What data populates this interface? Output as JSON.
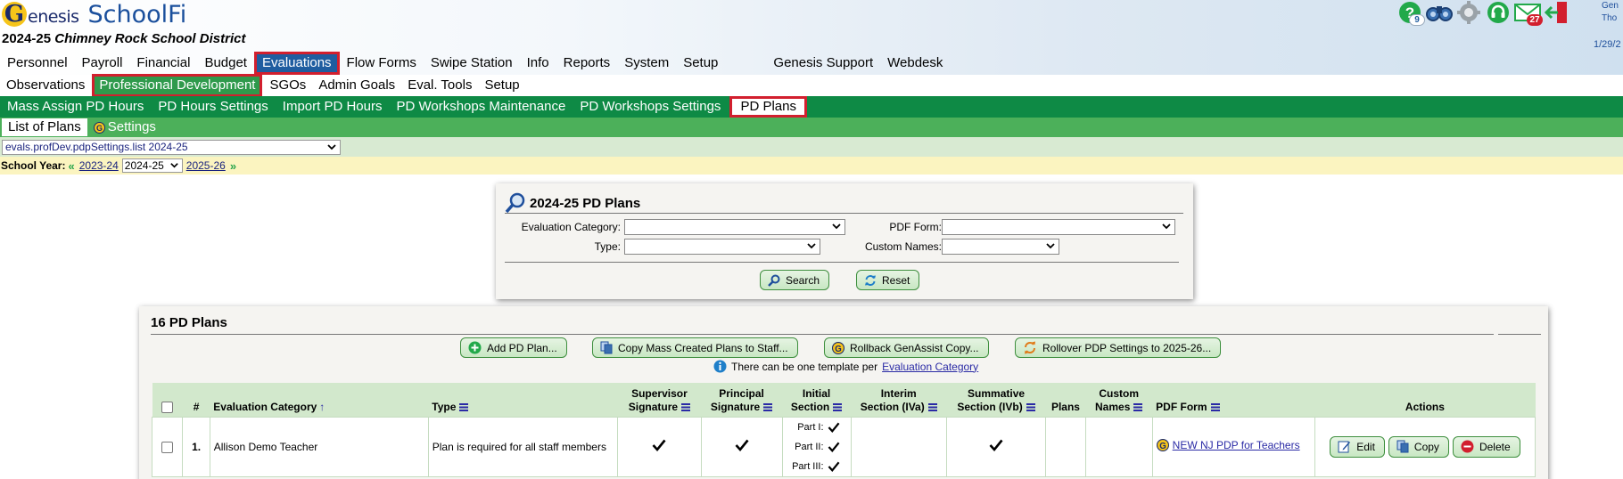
{
  "header": {
    "logo_text": "enesis",
    "logo_letter": "G",
    "app_name": "SchoolFi",
    "year_prefix": "2024-25",
    "district": "Chimney Rock School District",
    "user_line1": "Gen",
    "user_line2": "Tho",
    "date": "1/29/2",
    "help_badge": "9",
    "mail_badge": "27"
  },
  "topnav": [
    "Personnel",
    "Payroll",
    "Financial",
    "Budget",
    "Evaluations",
    "Flow Forms",
    "Swipe Station",
    "Info",
    "Reports",
    "System",
    "Setup",
    "Genesis Support",
    "Webdesk"
  ],
  "topnav_active": "Evaluations",
  "subnav": [
    "Observations",
    "Professional Development",
    "SGOs",
    "Admin Goals",
    "Eval. Tools",
    "Setup"
  ],
  "subnav_active": "Professional Development",
  "thirdnav": [
    "Mass Assign PD Hours",
    "PD Hours Settings",
    "Import PD Hours",
    "PD Workshops Maintenance",
    "PD Workshops Settings",
    "PD Plans"
  ],
  "thirdnav_active": "PD Plans",
  "fourthnav": {
    "list": "List of Plans",
    "settings": "Settings"
  },
  "page_select": "evals.profDev.pdpSettings.list 2024-25",
  "school_year": {
    "label": "School Year:",
    "prev": "2023-24",
    "current": "2024-25",
    "next": "2025-26"
  },
  "search": {
    "title": "2024-25 PD Plans",
    "eval_category_label": "Evaluation Category:",
    "pdf_form_label": "PDF Form:",
    "type_label": "Type:",
    "custom_names_label": "Custom Names:",
    "search_btn": "Search",
    "reset_btn": "Reset"
  },
  "results": {
    "title": "16 PD Plans",
    "add_btn": "Add PD Plan...",
    "copy_btn": "Copy Mass Created Plans to Staff...",
    "rollback_btn": "Rollback GenAssist Copy...",
    "rollover_btn": "Rollover PDP Settings to 2025-26...",
    "note_text": "There can be one template per",
    "note_link": "Evaluation Category",
    "columns": {
      "num": "#",
      "eval_category": "Evaluation Category",
      "type": "Type",
      "supervisor_sig_1": "Supervisor",
      "supervisor_sig_2": "Signature",
      "principal_sig_1": "Principal",
      "principal_sig_2": "Signature",
      "initial_1": "Initial",
      "initial_2": "Section",
      "interim_1": "Interim",
      "interim_2": "Section (IVa)",
      "summative_1": "Summative",
      "summative_2": "Section (IVb)",
      "plans": "Plans",
      "custom_1": "Custom",
      "custom_2": "Names",
      "pdf_form": "PDF Form",
      "actions": "Actions"
    },
    "rows": [
      {
        "num": "1.",
        "eval_category": "Allison Demo Teacher",
        "type": "Plan is required for all staff members",
        "part1": "Part I:",
        "part2": "Part II:",
        "part3": "Part III:",
        "pdf_form": "NEW NJ PDP for Teachers",
        "edit": "Edit",
        "copy": "Copy",
        "delete": "Delete"
      }
    ]
  },
  "colors": {
    "nav_blue": "#1f5da0",
    "nav_green_dark": "#0e8a45",
    "nav_green_light": "#4cb05a",
    "highlight_red": "#d21f2e",
    "link_blue": "#2a2aa5"
  }
}
